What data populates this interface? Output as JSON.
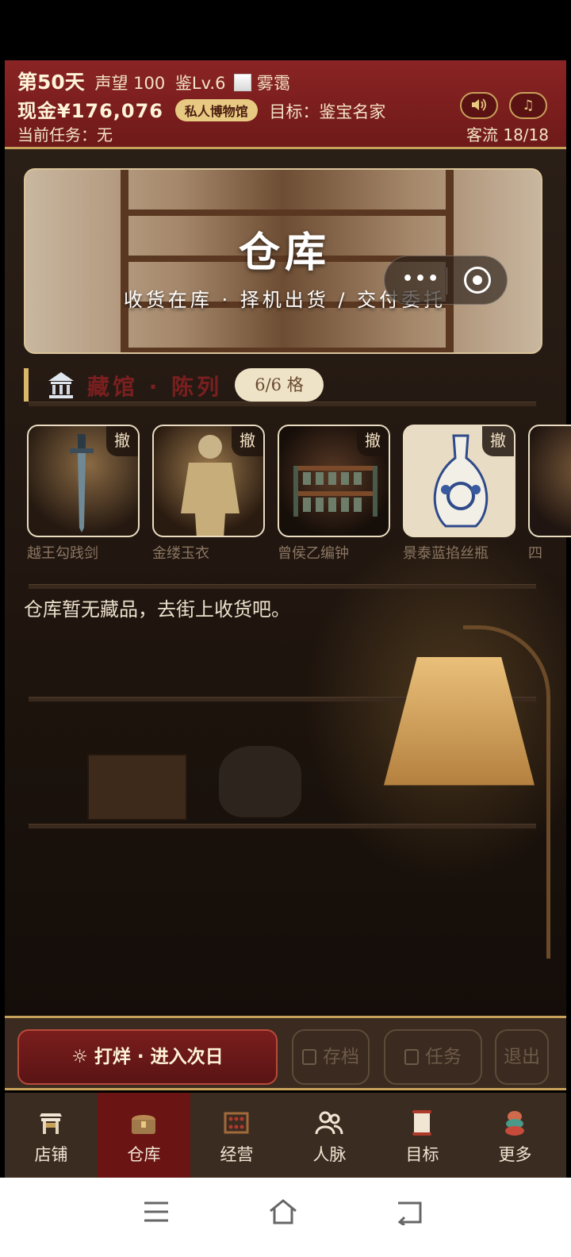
{
  "hud": {
    "day": "第50天",
    "reputation": "声望 100",
    "appraisal_level": "鉴Lv.6",
    "weather": "雾霭",
    "cash": "现金¥176,076",
    "shop_tier": "私人博物馆",
    "goal": "目标：鉴宝名家",
    "task": "当前任务：无",
    "traffic": "客流 18/18",
    "sound_icon": "speaker-icon",
    "music_icon": "music-note-icon"
  },
  "banner": {
    "title": "仓库",
    "subtitle": "收货在库 · 择机出货 / 交付委托"
  },
  "museum": {
    "title": "藏馆 · 陈列",
    "capacity": "6/6 格",
    "remove_label": "撤",
    "items": [
      {
        "name": "越王勾践剑"
      },
      {
        "name": "金缕玉衣"
      },
      {
        "name": "曾侯乙编钟"
      },
      {
        "name": "景泰蓝掐丝瓶"
      },
      {
        "name": "四"
      }
    ]
  },
  "warehouse": {
    "empty_text": "仓库暂无藏品，去街上收货吧。"
  },
  "actions": {
    "close_label": "☼ 打烊 · 进入次日",
    "save_label": "存档",
    "tasks_label": "任务",
    "exit_label": "退出"
  },
  "nav": {
    "items": [
      {
        "label": "店铺",
        "icon": "shop-icon"
      },
      {
        "label": "仓库",
        "icon": "treasure-chest-icon"
      },
      {
        "label": "经营",
        "icon": "abacus-icon"
      },
      {
        "label": "人脉",
        "icon": "people-icon"
      },
      {
        "label": "目标",
        "icon": "scroll-icon"
      },
      {
        "label": "更多",
        "icon": "more-icon"
      }
    ],
    "active": "仓库"
  },
  "colors": {
    "accent_red": "#7a1d1d",
    "gold": "#c8a15a",
    "nav_bg": "#3b2c22"
  }
}
